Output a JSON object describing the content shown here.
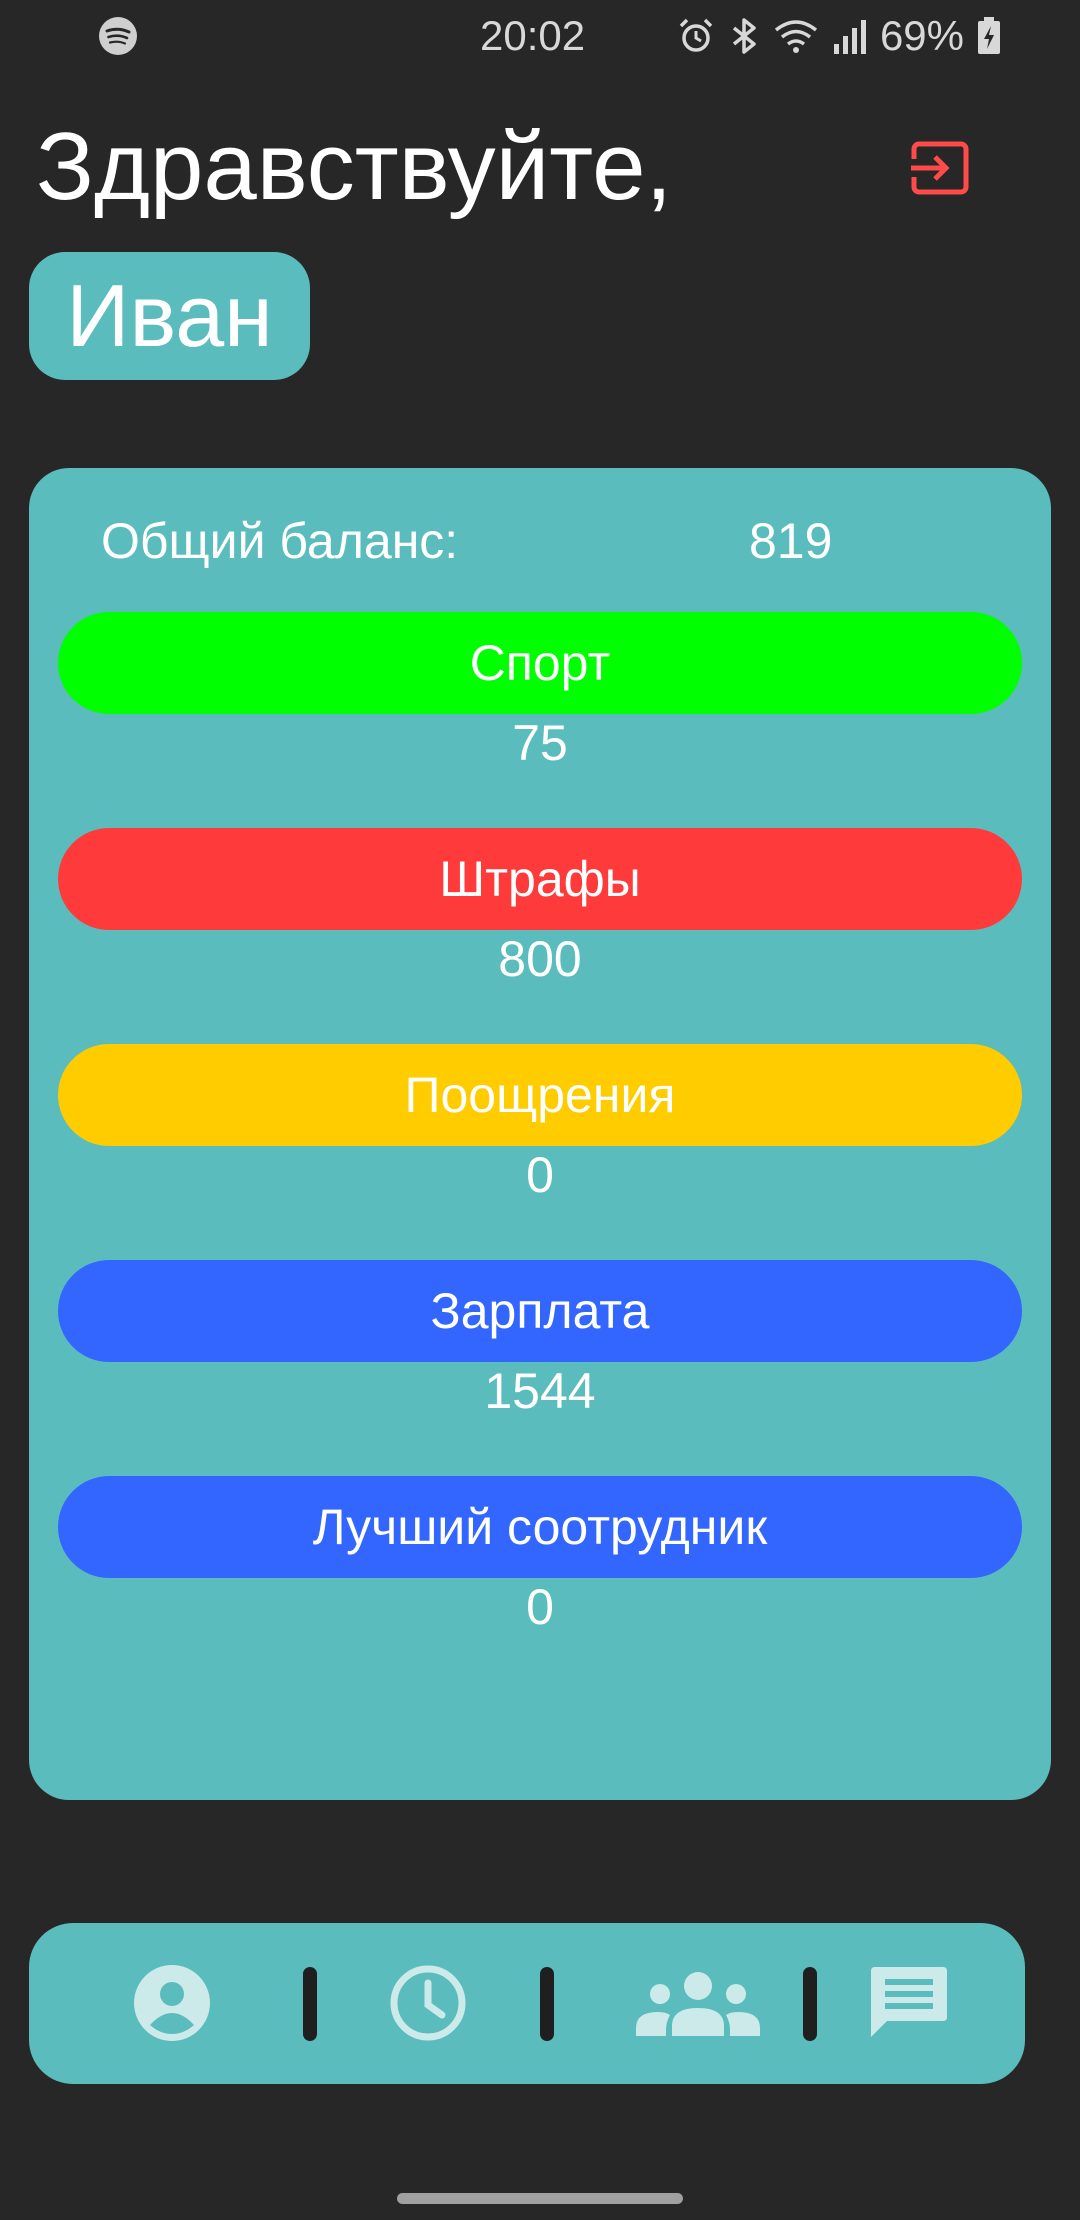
{
  "status_bar": {
    "time": "20:02",
    "battery": "69%",
    "left_icon": "spotify-icon",
    "right_icons": [
      "alarm-icon",
      "bluetooth-icon",
      "wifi-icon",
      "signal-icon",
      "battery-charging-icon"
    ]
  },
  "header": {
    "greeting": "Здравствуйте,",
    "name": "Иван",
    "logout_icon": "logout-icon"
  },
  "balance": {
    "label": "Общий баланс:",
    "value": "819",
    "categories": [
      {
        "label": "Спорт",
        "value": "75",
        "color": "#00ff00"
      },
      {
        "label": "Штрафы",
        "value": "800",
        "color": "#ff3a3a"
      },
      {
        "label": "Поощрения",
        "value": "0",
        "color": "#ffcc00"
      },
      {
        "label": "Зарплата",
        "value": "1544",
        "color": "#3366ff"
      },
      {
        "label": "Лучший соотрудник",
        "value": "0",
        "color": "#3366ff"
      }
    ]
  },
  "bottom_nav": {
    "items": [
      {
        "icon": "profile-icon"
      },
      {
        "icon": "clock-icon"
      },
      {
        "icon": "group-icon"
      },
      {
        "icon": "chat-icon"
      }
    ]
  },
  "colors": {
    "background": "#272727",
    "card": "#5bbcbd",
    "accent_logout": "#ff4a4a",
    "nav_icon": "#cdeaea"
  }
}
